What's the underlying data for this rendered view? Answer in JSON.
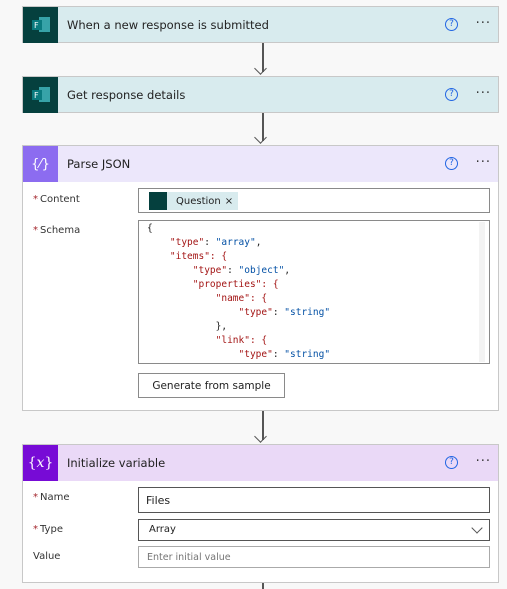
{
  "steps": [
    {
      "title": "When a new response is submitted",
      "icon": "forms-icon",
      "color": "#d8ebee",
      "icon_bg": "#05403e"
    },
    {
      "title": "Get response details",
      "icon": "forms-icon",
      "color": "#d8ebee",
      "icon_bg": "#05403e"
    },
    {
      "title": "Parse JSON",
      "icon": "parse-json-icon",
      "color": "#ece7fb",
      "icon_bg": "#8c6cf0",
      "content_label": "Content",
      "content_token": "Question",
      "schema_label": "Schema",
      "schema_lines": [
        "{",
        "    \"type\": \"array\",",
        "    \"items\": {",
        "        \"type\": \"object\",",
        "        \"properties\": {",
        "            \"name\": {",
        "                \"type\": \"string\"",
        "            },",
        "            \"link\": {",
        "                \"type\": \"string\""
      ],
      "generate_button": "Generate from sample"
    },
    {
      "title": "Initialize variable",
      "icon": "variable-icon",
      "color": "#ead9f7",
      "icon_bg": "#770bd6",
      "name_label": "Name",
      "name_value": "Files",
      "type_label": "Type",
      "type_value": "Array",
      "value_label": "Value",
      "value_placeholder": "Enter initial value"
    }
  ],
  "help_glyph": "?",
  "more_glyph": "···",
  "required_mark": "*",
  "remove_glyph": "×"
}
